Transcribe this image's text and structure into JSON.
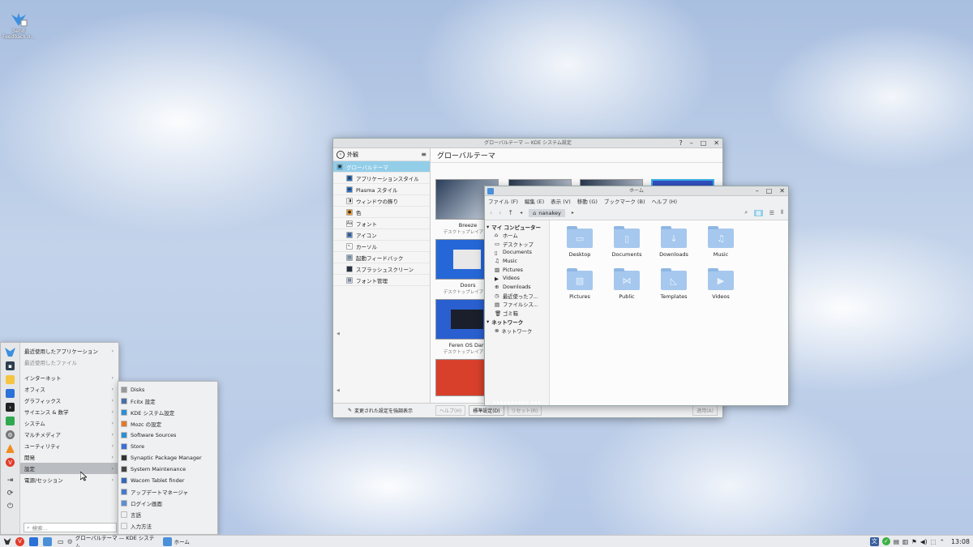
{
  "desktop": {
    "icon_label": "Send Feedback o..."
  },
  "kde": {
    "title": "グローバルテーマ — KDE システム設定",
    "sidebar_title": "外観",
    "page_title": "グローバルテーマ",
    "items": [
      {
        "label": "グローバルテーマ"
      },
      {
        "label": "アプリケーションスタイル"
      },
      {
        "label": "Plasma スタイル"
      },
      {
        "label": "ウィンドウの飾り"
      },
      {
        "label": "色"
      },
      {
        "label": "フォント"
      },
      {
        "label": "アイコン"
      },
      {
        "label": "カーソル"
      },
      {
        "label": "起動フィードバック"
      },
      {
        "label": "スプラッシュスクリーン"
      },
      {
        "label": "フォント管理"
      }
    ],
    "themes": [
      {
        "name": "Breeze",
        "sub": "デスクトップレイアウト"
      },
      {
        "name": "Doors",
        "sub": "デスクトップレイアウト"
      },
      {
        "name": "Feren OS Dark",
        "sub": "デスクトップレイアウト"
      }
    ],
    "highlight_label": "変更された設定を強調表示",
    "help_btn": "ヘルプ(H)",
    "defaults_btn": "標準設定(D)",
    "reset_btn": "リセット(R)",
    "apply_btn": "適用(A)"
  },
  "dolphin": {
    "title": "ホーム",
    "menus": [
      "ファイル (F)",
      "編集 (E)",
      "表示 (V)",
      "移動 (G)",
      "ブックマーク (B)",
      "ヘルプ (H)"
    ],
    "breadcrumb": "nanakey",
    "places_header": "マイ コンピューター",
    "places": [
      "ホーム",
      "デスクトップ",
      "Documents",
      "Music",
      "Pictures",
      "Videos",
      "Downloads",
      "最近使ったフ...",
      "ファイルシス...",
      "ゴミ箱"
    ],
    "network_header": "ネットワーク",
    "network_items": [
      "ネットワーク"
    ],
    "folders": [
      "Desktop",
      "Documents",
      "Downloads",
      "Music",
      "Pictures",
      "Public",
      "Templates",
      "Videos"
    ]
  },
  "start_menu": {
    "items": [
      {
        "label": "最近使用したアプリケーション",
        "arrow": true
      },
      {
        "label": "最近使用したファイル",
        "arrow": false
      },
      {
        "label": "インターネット",
        "arrow": true
      },
      {
        "label": "オフィス",
        "arrow": true
      },
      {
        "label": "グラフィックス",
        "arrow": true
      },
      {
        "label": "サイエンス & 数学",
        "arrow": true
      },
      {
        "label": "システム",
        "arrow": true
      },
      {
        "label": "マルチメディア",
        "arrow": true
      },
      {
        "label": "ユーティリティ",
        "arrow": true
      },
      {
        "label": "開発",
        "arrow": true
      },
      {
        "label": "設定",
        "arrow": true
      },
      {
        "label": "電源/セッション",
        "arrow": true
      }
    ],
    "search_placeholder": "検索...",
    "submenu": [
      "Disks",
      "Fcitx 設定",
      "KDE システム設定",
      "Mozc の設定",
      "Software Sources",
      "Store",
      "Synaptic Package Manager",
      "System Maintenance",
      "Wacom Tablet finder",
      "アップデートマネージャ",
      "ログイン画面",
      "言語",
      "入力方法"
    ]
  },
  "taskbar": {
    "task1": "グローバルテーマ — KDE システム...",
    "task2": "ホーム",
    "clock": "13:08"
  }
}
